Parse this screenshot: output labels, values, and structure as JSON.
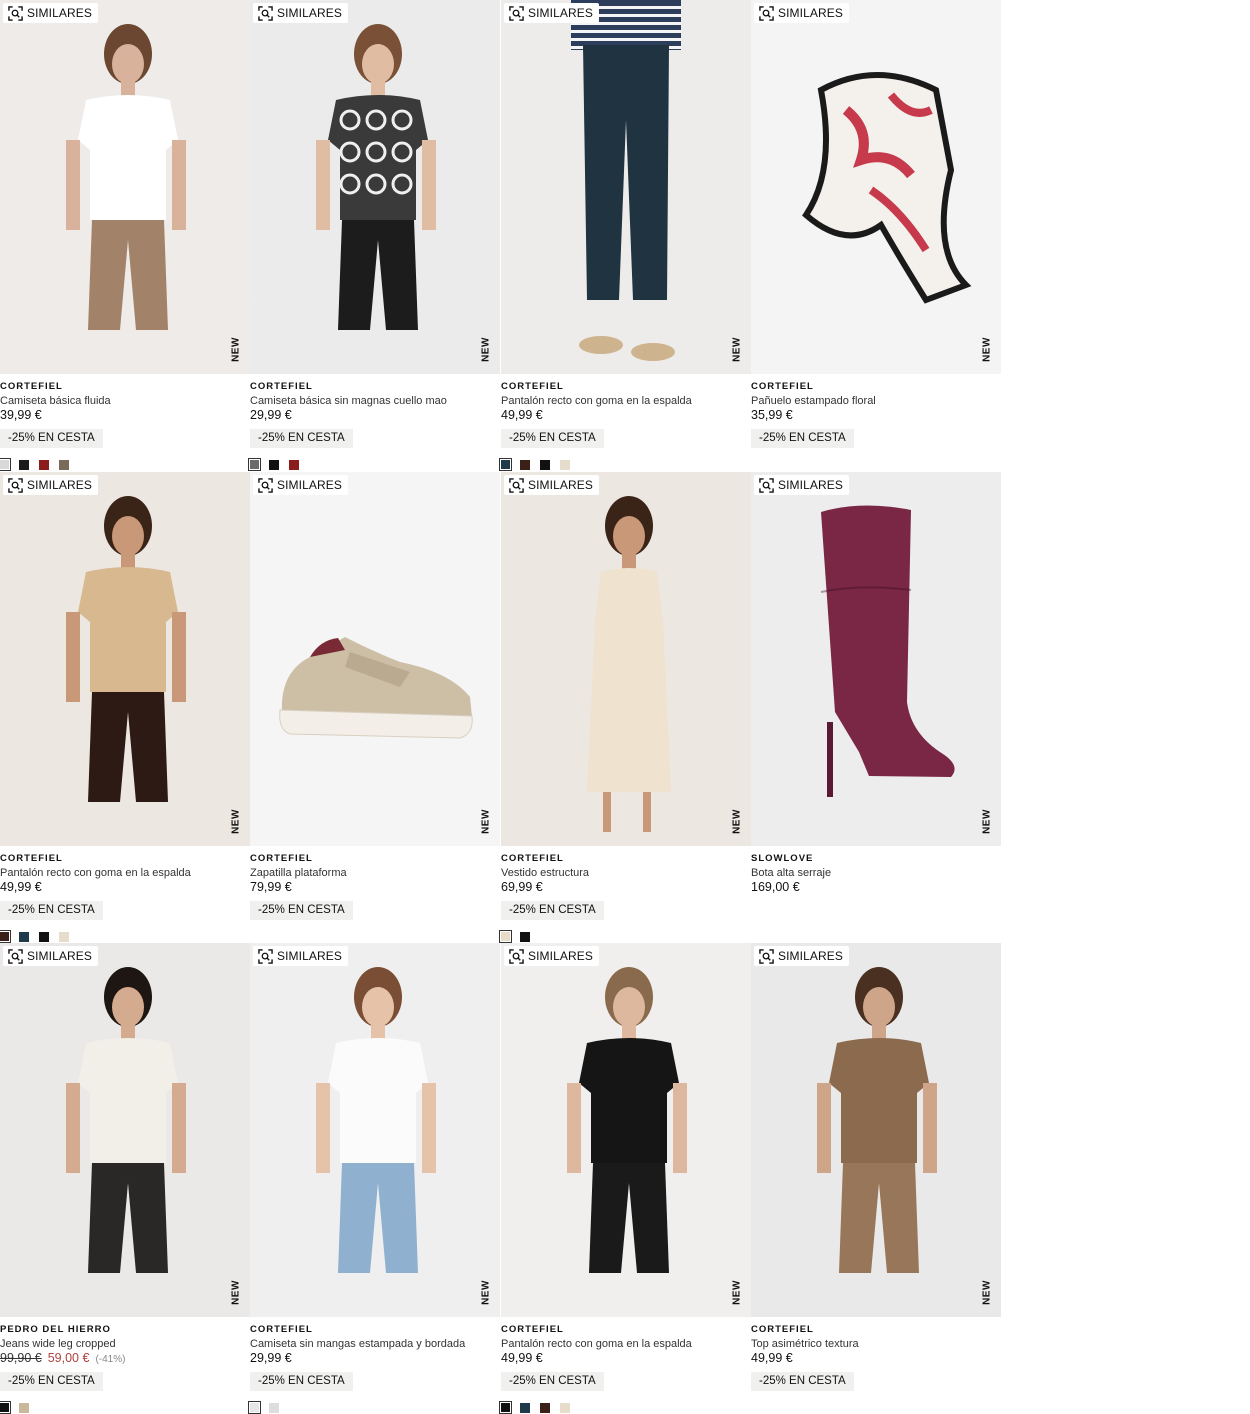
{
  "labels": {
    "similares": "SIMILARES",
    "new": "NEW"
  },
  "products": [
    {
      "brand": "CORTEFIEL",
      "name": "Camiseta básica fluida",
      "price": "39,99 €",
      "promo": "-25% EN CESTA",
      "swatches": [
        "#d9d9d9",
        "#1a1a1a",
        "#8a1c1c",
        "#7a6a5a"
      ],
      "selected_swatch": 0,
      "art": {
        "bg": "#eeebe8",
        "kind": "person",
        "top": "#ffffff",
        "bottom": "#a2836a",
        "skin": "#d8b29a",
        "hair": "#6b4630"
      }
    },
    {
      "brand": "CORTEFIEL",
      "name": "Camiseta básica sin magnas cuello mao",
      "price": "29,99 €",
      "promo": "-25% EN CESTA",
      "swatches": [
        "#6b6b6b",
        "#111111",
        "#8a1c1c"
      ],
      "selected_swatch": 0,
      "art": {
        "bg": "#ebebeb",
        "kind": "person",
        "top": "#3a3a3a",
        "bottom": "#1c1c1c",
        "skin": "#e0bca3",
        "hair": "#7a5036",
        "pattern": true
      }
    },
    {
      "brand": "CORTEFIEL",
      "name": "Pantalón recto con goma en la espalda",
      "price": "49,99 €",
      "promo": "-25% EN CESTA",
      "swatches": [
        "#1f3a4a",
        "#3b2018",
        "#111111",
        "#e6dccb"
      ],
      "selected_swatch": 0,
      "art": {
        "bg": "#eeeceb",
        "kind": "pants",
        "top": "#2c3e5c",
        "bottom": "#1f3340",
        "skin": "#d8b29a",
        "hair": "#6b4630"
      }
    },
    {
      "brand": "CORTEFIEL",
      "name": "Pañuelo estampado floral",
      "price": "35,99 €",
      "promo": "-25% EN CESTA",
      "swatches": [],
      "selected_swatch": -1,
      "art": {
        "bg": "#f4f4f4",
        "kind": "scarf",
        "top": "#c63a4c",
        "bottom": "#1a1a1a",
        "skin": "#f4f0ec",
        "hair": "#1a1a1a"
      }
    },
    {
      "brand": "CORTEFIEL",
      "name": "Pantalón recto con goma en la espalda",
      "price": "49,99 €",
      "promo": "-25% EN CESTA",
      "swatches": [
        "#3b2018",
        "#1f3a4a",
        "#111111",
        "#e6dccb"
      ],
      "selected_swatch": 0,
      "art": {
        "bg": "#ece7e1",
        "kind": "person",
        "top": "#d8b88f",
        "bottom": "#2e1a15",
        "skin": "#c89878",
        "hair": "#3a2418"
      }
    },
    {
      "brand": "CORTEFIEL",
      "name": "Zapatilla plataforma",
      "price": "79,99 €",
      "promo": "-25% EN CESTA",
      "swatches": [],
      "selected_swatch": -1,
      "art": {
        "bg": "#f5f5f5",
        "kind": "sneaker",
        "top": "#cdbfa6",
        "bottom": "#f3efe8",
        "skin": "#7a2a34",
        "hair": "#b9aa90"
      }
    },
    {
      "brand": "CORTEFIEL",
      "name": "Vestido estructura",
      "price": "69,99 €",
      "promo": "-25% EN CESTA",
      "swatches": [
        "#e8dcc6",
        "#111111"
      ],
      "selected_swatch": 0,
      "art": {
        "bg": "#ece7e1",
        "kind": "dress",
        "top": "#efe3cf",
        "bottom": "#efe3cf",
        "skin": "#c89878",
        "hair": "#3a2418"
      }
    },
    {
      "brand": "SLOWLOVE",
      "name": "Bota alta serraje",
      "price": "169,00 €",
      "promo": "",
      "swatches": [],
      "selected_swatch": -1,
      "art": {
        "bg": "#ededed",
        "kind": "boot",
        "top": "#7a2645",
        "bottom": "#5a1a33",
        "skin": "#7a2645",
        "hair": "#3a0f20"
      }
    },
    {
      "brand": "PEDRO DEL HIERRO",
      "name": "Jeans wide leg cropped",
      "price_old": "99,90 €",
      "price": "59,00 €",
      "discount": "(-41%)",
      "promo": "-25% EN CESTA",
      "swatches": [
        "#111111",
        "#c9b89a"
      ],
      "selected_swatch": 0,
      "art": {
        "bg": "#ebe9e7",
        "kind": "person",
        "top": "#f2efe9",
        "bottom": "#2a2826",
        "skin": "#d4ab8e",
        "hair": "#1d1612"
      }
    },
    {
      "brand": "CORTEFIEL",
      "name": "Camiseta sin mangas estampada y bordada",
      "price": "29,99 €",
      "promo": "-25% EN CESTA",
      "swatches": [
        "#e6e6e6",
        "#dddddd"
      ],
      "selected_swatch": 0,
      "art": {
        "bg": "#efefef",
        "kind": "person",
        "top": "#fbfbfb",
        "bottom": "#8fb0cf",
        "skin": "#e6c3a8",
        "hair": "#7a4e34"
      }
    },
    {
      "brand": "CORTEFIEL",
      "name": "Pantalón recto con goma en la espalda",
      "price": "49,99 €",
      "promo": "-25% EN CESTA",
      "swatches": [
        "#111111",
        "#1f3a4a",
        "#3b2018",
        "#e6dccb"
      ],
      "selected_swatch": 0,
      "art": {
        "bg": "#f1efed",
        "kind": "person",
        "top": "#151515",
        "bottom": "#1a1a1a",
        "skin": "#ddb89e",
        "hair": "#8a6a4c"
      }
    },
    {
      "brand": "CORTEFIEL",
      "name": "Top asimétrico textura",
      "price": "49,99 €",
      "promo": "-25% EN CESTA",
      "swatches": [],
      "selected_swatch": -1,
      "art": {
        "bg": "#e9e9e9",
        "kind": "person",
        "top": "#8b6a4e",
        "bottom": "#987659",
        "skin": "#cfa58a",
        "hair": "#4a3020"
      }
    }
  ]
}
